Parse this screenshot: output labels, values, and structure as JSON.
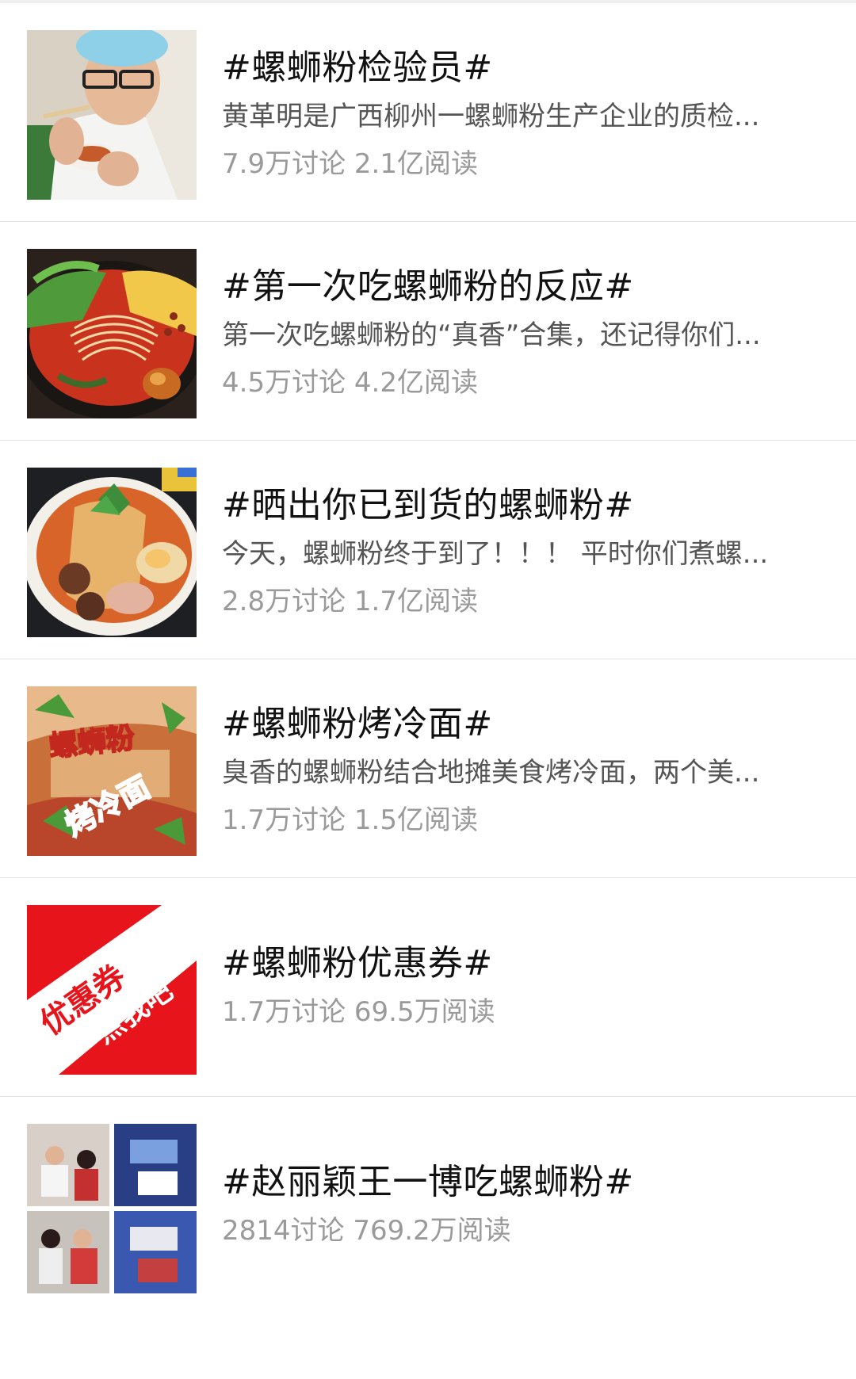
{
  "topics": [
    {
      "title": "#螺蛳粉检验员#",
      "description": "黄革明是广西柳州一螺蛳粉生产企业的质检...",
      "stats": "7.9万讨论 2.1亿阅读",
      "thumbnail": "man-tasting-soup"
    },
    {
      "title": "#第一次吃螺蛳粉的反应#",
      "description": "第一次吃螺蛳粉的“真香”合集，还记得你们...",
      "stats": "4.5万讨论 4.2亿阅读",
      "thumbnail": "noodle-bowl"
    },
    {
      "title": "#晒出你已到货的螺蛳粉#",
      "description": "今天，螺蛳粉终于到了！！！ 平时你们煮螺...",
      "stats": "2.8万讨论 1.7亿阅读",
      "thumbnail": "snail-noodle-bowl"
    },
    {
      "title": "#螺蛳粉烤冷面#",
      "description": "臭香的螺蛳粉结合地摊美食烤冷面，两个美...",
      "stats": "1.7万讨论 1.5亿阅读",
      "thumbnail": "grilled-cold-noodle",
      "thumbnail_text": [
        "螺蛳粉",
        "烤冷面"
      ]
    },
    {
      "title": "#螺蛳粉优惠券#",
      "description": "",
      "stats": "1.7万讨论 69.5万阅读",
      "thumbnail": "coupon-banner",
      "thumbnail_text": [
        "优惠券",
        "点我吧"
      ]
    },
    {
      "title": "#赵丽颖王一博吃螺蛳粉#",
      "description": "",
      "stats": "2814讨论 769.2万阅读",
      "thumbnail": "photo-collage"
    }
  ],
  "colors": {
    "title": "#111111",
    "description": "#555555",
    "stats": "#9a9a9a",
    "divider": "#e2e2e2",
    "coupon_red": "#e8141b"
  }
}
